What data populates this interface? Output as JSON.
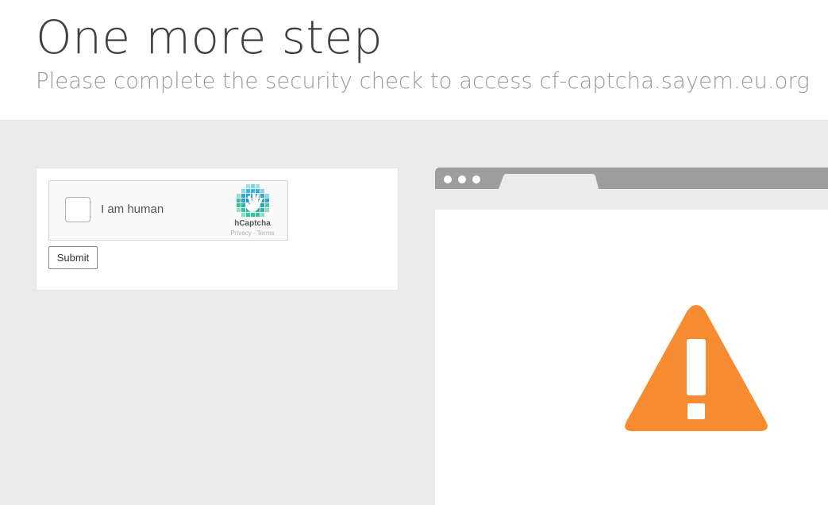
{
  "header": {
    "title": "One more step",
    "subtitle": "Please complete the security check to access cf-captcha.sayem.eu.org"
  },
  "captcha": {
    "checkbox_label": "I am human",
    "brand_name": "hCaptcha",
    "privacy_link": "Privacy",
    "link_separator": "-",
    "terms_link": "Terms",
    "checked": false,
    "submit_label": "Submit"
  },
  "illustration": {
    "icon": "warning-triangle-icon",
    "warning_color": "#f68b31",
    "browser_chrome_color": "#9e9e9e"
  },
  "colors": {
    "page_background": "#ebebeb",
    "header_background": "#ffffff",
    "title_text": "#404040",
    "subtitle_text": "#9a9a9a"
  }
}
